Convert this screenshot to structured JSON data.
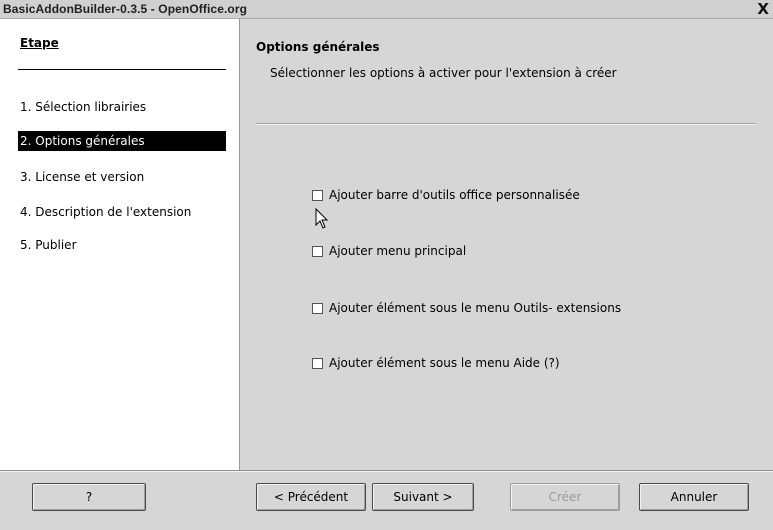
{
  "window": {
    "title": "BasicAddonBuilder-0.3.5 - OpenOffice.org",
    "close_glyph": "X"
  },
  "sidebar": {
    "heading": "Etape",
    "steps": [
      {
        "label": "1. Sélection librairies",
        "active": false
      },
      {
        "label": "2. Options générales",
        "active": true
      },
      {
        "label": "3. License et version",
        "active": false
      },
      {
        "label": "4. Description de l'extension",
        "active": false
      },
      {
        "label": "5. Publier",
        "active": false
      }
    ]
  },
  "main": {
    "title": "Options générales",
    "subtitle": "Sélectionner les options à activer pour l'extension à créer",
    "options": [
      {
        "label": "Ajouter barre d'outils office personnalisée",
        "checked": false
      },
      {
        "label": "Ajouter menu principal",
        "checked": false
      },
      {
        "label": "Ajouter élément sous le menu Outils- extensions",
        "checked": false
      },
      {
        "label": "Ajouter élément sous le menu Aide (?)",
        "checked": false
      }
    ]
  },
  "buttons": {
    "help": "?",
    "previous": "< Précédent",
    "next": "Suivant >",
    "create": "Créer",
    "cancel": "Annuler"
  },
  "icons": {
    "close": "close-icon",
    "cursor": "mouse-pointer-icon",
    "checkbox": "checkbox-icon"
  }
}
